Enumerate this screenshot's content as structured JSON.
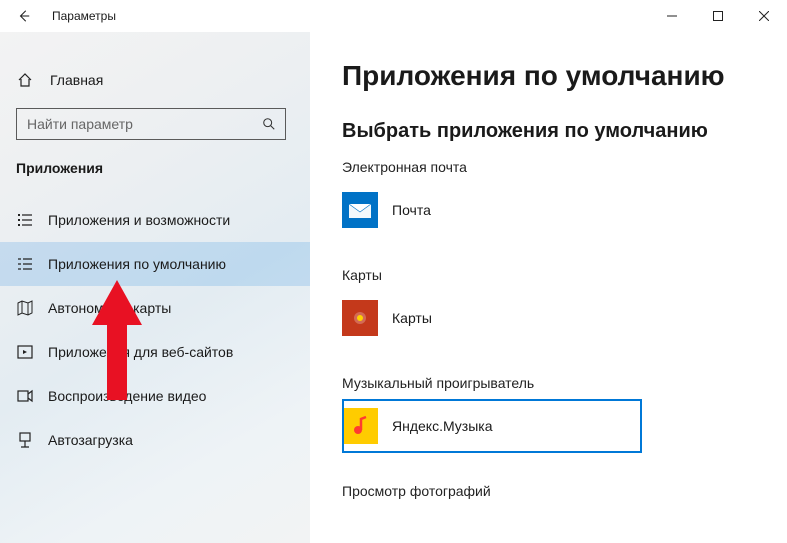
{
  "window": {
    "title": "Параметры"
  },
  "sidebar": {
    "home": "Главная",
    "search_placeholder": "Найти параметр",
    "section": "Приложения",
    "items": [
      {
        "label": "Приложения и возможности"
      },
      {
        "label": "Приложения по умолчанию"
      },
      {
        "label": "Автономные карты"
      },
      {
        "label": "Приложения для веб-сайтов"
      },
      {
        "label": "Воспроизведение видео"
      },
      {
        "label": "Автозагрузка"
      }
    ],
    "selected_index": 1
  },
  "main": {
    "title": "Приложения по умолчанию",
    "subtitle": "Выбрать приложения по умолчанию",
    "categories": [
      {
        "label": "Электронная почта",
        "app": "Почта",
        "icon": "mail"
      },
      {
        "label": "Карты",
        "app": "Карты",
        "icon": "maps"
      },
      {
        "label": "Музыкальный проигрыватель",
        "app": "Яндекс.Музыка",
        "icon": "music",
        "selected": true
      },
      {
        "label": "Просмотр фотографий",
        "app": "",
        "icon": ""
      }
    ]
  },
  "annotation": {
    "arrow_target": "Приложения по умолчанию"
  }
}
